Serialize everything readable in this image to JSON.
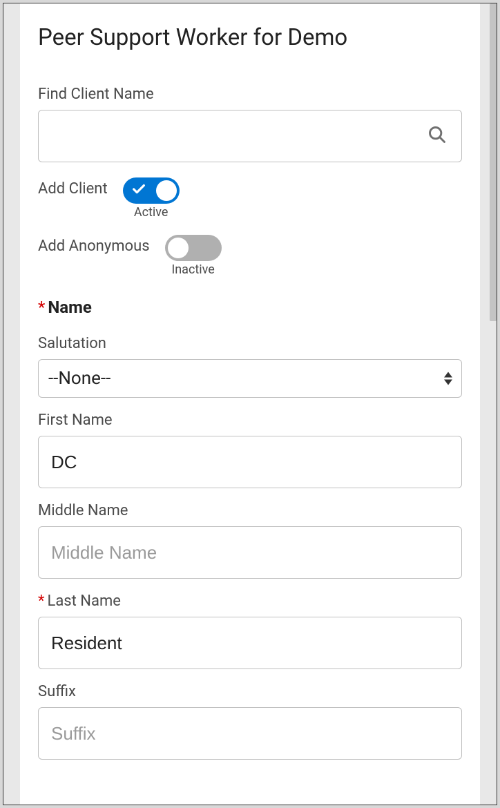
{
  "page_title": "Peer Support Worker for Demo",
  "find_client": {
    "label": "Find Client Name",
    "value": ""
  },
  "add_client": {
    "label": "Add Client",
    "state_label": "Active",
    "on": true
  },
  "add_anonymous": {
    "label": "Add Anonymous",
    "state_label": "Inactive",
    "on": false
  },
  "name_section": {
    "label": "Name",
    "salutation": {
      "label": "Salutation",
      "value": "--None--"
    },
    "first_name": {
      "label": "First Name",
      "value": "DC"
    },
    "middle_name": {
      "label": "Middle Name",
      "value": "",
      "placeholder": "Middle Name"
    },
    "last_name": {
      "label": "Last Name",
      "value": "Resident"
    },
    "suffix": {
      "label": "Suffix",
      "value": "",
      "placeholder": "Suffix"
    }
  }
}
